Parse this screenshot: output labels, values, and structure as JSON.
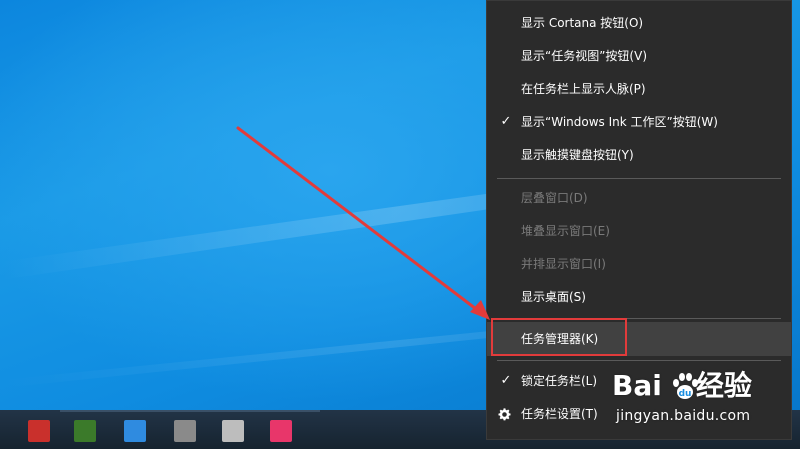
{
  "context_menu": {
    "items": [
      {
        "label": "显示 Cortana 按钮(O)",
        "checked": false,
        "disabled": false
      },
      {
        "label": "显示“任务视图”按钮(V)",
        "checked": false,
        "disabled": false
      },
      {
        "label": "在任务栏上显示人脉(P)",
        "checked": false,
        "disabled": false
      },
      {
        "label": "显示“Windows Ink 工作区”按钮(W)",
        "checked": true,
        "disabled": false
      },
      {
        "label": "显示触摸键盘按钮(Y)",
        "checked": false,
        "disabled": false
      },
      {
        "label": "层叠窗口(D)",
        "checked": false,
        "disabled": true
      },
      {
        "label": "堆叠显示窗口(E)",
        "checked": false,
        "disabled": true
      },
      {
        "label": "并排显示窗口(I)",
        "checked": false,
        "disabled": true
      },
      {
        "label": "显示桌面(S)",
        "checked": false,
        "disabled": false
      },
      {
        "label": "任务管理器(K)",
        "checked": false,
        "disabled": false,
        "highlighted": true
      },
      {
        "label": "锁定任务栏(L)",
        "checked": true,
        "disabled": false
      },
      {
        "label": "任务栏设置(T)",
        "checked": false,
        "disabled": false,
        "icon": "gear-icon"
      }
    ],
    "check_glyph": "✓"
  },
  "annotation": {
    "arrow_color": "#e23b3b",
    "box_color": "#e23b3b"
  },
  "taskbar": {
    "icons": [
      {
        "name": "app-icon-red",
        "color": "#c9302c"
      },
      {
        "name": "app-icon-green",
        "color": "#3b7a2a"
      },
      {
        "name": "app-icon-blue",
        "color": "#2f8be0"
      },
      {
        "name": "app-icon-gray",
        "color": "#8a8a8a"
      },
      {
        "name": "app-icon-light",
        "color": "#bdbdbd"
      },
      {
        "name": "app-icon-pink",
        "color": "#e8366a"
      }
    ]
  },
  "watermark": {
    "brand_left": "Bai",
    "brand_right": "经验",
    "url": "jingyan.baidu.com"
  }
}
